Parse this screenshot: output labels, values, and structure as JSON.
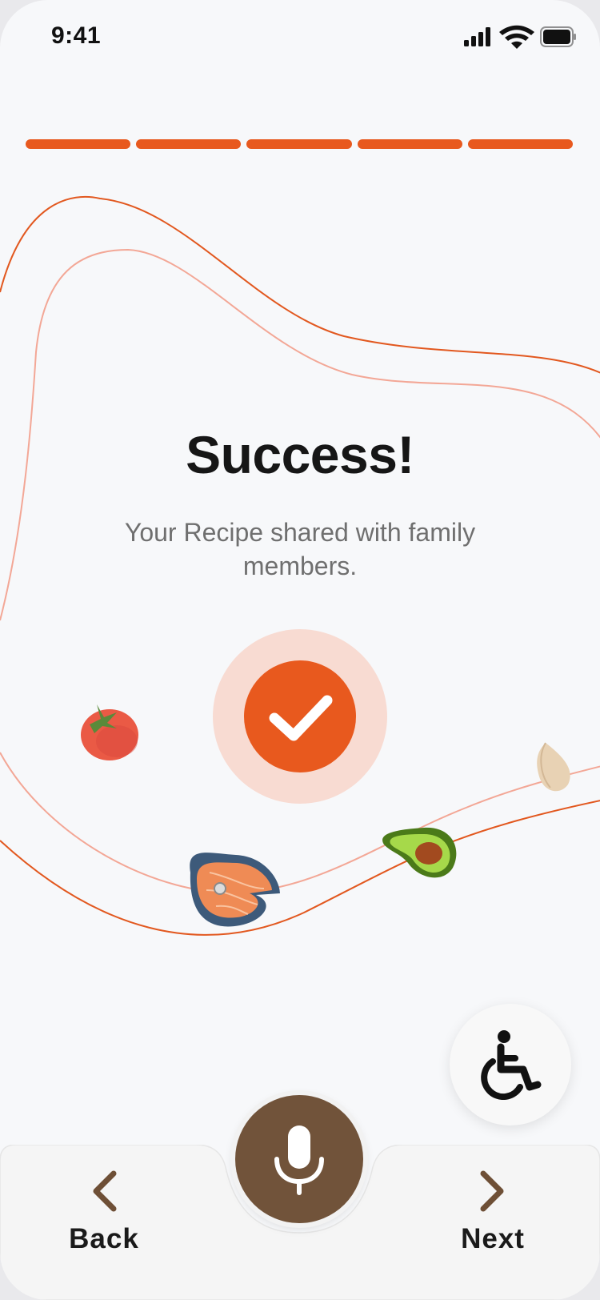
{
  "status_bar": {
    "time": "9:41"
  },
  "progress": {
    "total_steps": 5,
    "completed_steps": 5,
    "color": "#e8591e"
  },
  "message": {
    "title": "Success!",
    "subtitle": "Your Recipe shared with family members."
  },
  "icons": {
    "success": "checkmark-icon",
    "accessibility": "wheelchair-icon",
    "voice": "microphone-icon",
    "back": "chevron-left-icon",
    "next": "chevron-right-icon",
    "decorations": [
      "tomato-icon",
      "salmon-steak-icon",
      "avocado-icon",
      "garlic-clove-icon"
    ]
  },
  "nav": {
    "back_label": "Back",
    "next_label": "Next"
  },
  "colors": {
    "accent": "#e8591e",
    "accent_soft": "#f8dbd2",
    "mic_brown": "#71533a",
    "chevron_brown": "#6e4f36",
    "background": "#f7f8fa"
  }
}
